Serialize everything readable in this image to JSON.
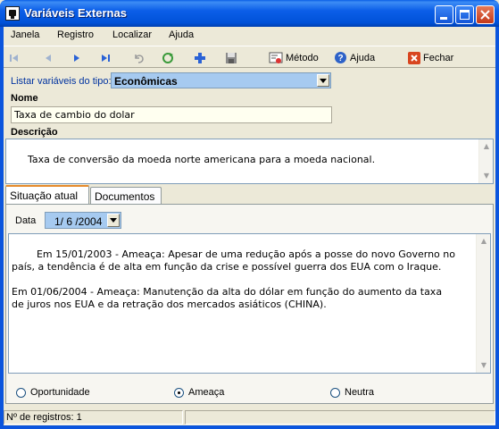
{
  "window": {
    "title": "Variáveis Externas"
  },
  "menu": [
    {
      "label": "Janela"
    },
    {
      "label": "Registro"
    },
    {
      "label": "Localizar"
    },
    {
      "label": "Ajuda"
    }
  ],
  "toolbar": {
    "metodo_label": "Método",
    "ajuda_label": "Ajuda",
    "fechar_label": "Fechar"
  },
  "filter": {
    "label": "Listar variáveis do tipo:",
    "value": "Econômicas"
  },
  "nome": {
    "label": "Nome",
    "value": "Taxa de cambio do dolar"
  },
  "descricao": {
    "label": "Descrição",
    "value": "Taxa de conversão da moeda norte americana para a moeda nacional."
  },
  "tabs": [
    {
      "label": "Situação atual",
      "active": true
    },
    {
      "label": "Documentos",
      "active": false
    }
  ],
  "situacao": {
    "date_label": "Data",
    "date_value": "1/ 6 /2004",
    "text": "Em 15/01/2003 - Ameaça: Apesar de uma redução após a posse do novo Governo no\npaís, a tendência é de alta em função da crise e possível guerra dos EUA com o Iraque.\n\nEm 01/06/2004 - Ameaça: Manutenção da alta do dólar em função do aumento da taxa\nde juros nos EUA e da retração dos mercados asiáticos (CHINA).",
    "options": [
      {
        "label": "Oportunidade",
        "checked": false
      },
      {
        "label": "Ameaça",
        "checked": true
      },
      {
        "label": "Neutra",
        "checked": false
      }
    ]
  },
  "status": {
    "records": "Nº de registros: 1"
  }
}
